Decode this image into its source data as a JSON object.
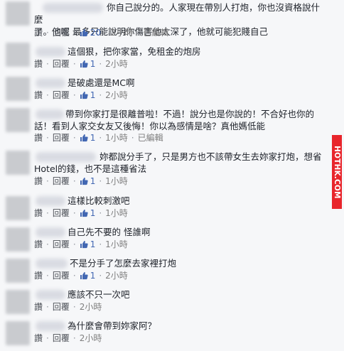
{
  "action_labels": {
    "reply": "讚",
    "respond": "回覆",
    "separator": "·"
  },
  "comments": [
    {
      "text": "你自己說分的。人家現在帶別人打炮，你也沒資格說什麼\n了。他呢 最多只能說明你傷害他太深了，他就可能犯賤自己",
      "likes": "20",
      "time": "2小時",
      "edited": "已編輯"
    },
    {
      "text": "這個狠，把你家當，免租金的炮房",
      "likes": "1",
      "time": "2小時",
      "edited": ""
    },
    {
      "text": "是破處還是MC啊",
      "likes": "1",
      "time": "2小時",
      "edited": ""
    },
    {
      "text": "帶到你家打是很離普啦！不過！說分也是你說的！不合好也你的\n話！看到人家交女友又後悔！你以為感情是啥？真他媽低能",
      "likes": "1",
      "time": "1小時",
      "edited": "已編輯"
    },
    {
      "text": "妳都說分手了，只是男方也不該帶女生去妳家打炮，想省\nHotel的錢，也不是這種省法",
      "likes": "1",
      "time": "1小時",
      "edited": ""
    },
    {
      "text": "這樣比較刺激吧",
      "likes": "1",
      "time": "1小時",
      "edited": ""
    },
    {
      "text": "自己先不要的 怪誰啊",
      "likes": "1",
      "time": "1小時",
      "edited": ""
    },
    {
      "text": "不是分手了怎麼去家裡打炮",
      "likes": "1",
      "time": "2小時",
      "edited": ""
    },
    {
      "text": "應該不只一次吧",
      "likes": "",
      "time": "2小時",
      "edited": ""
    },
    {
      "text": "為什麼會帶到妳家阿？",
      "likes": "",
      "time": "2小時",
      "edited": ""
    }
  ],
  "watermark": "HOTHK.COM",
  "colors": {
    "background": "#f6f7f9",
    "link": "#4267b2",
    "meta": "#90949c",
    "watermark_bg": "#e8252c"
  }
}
